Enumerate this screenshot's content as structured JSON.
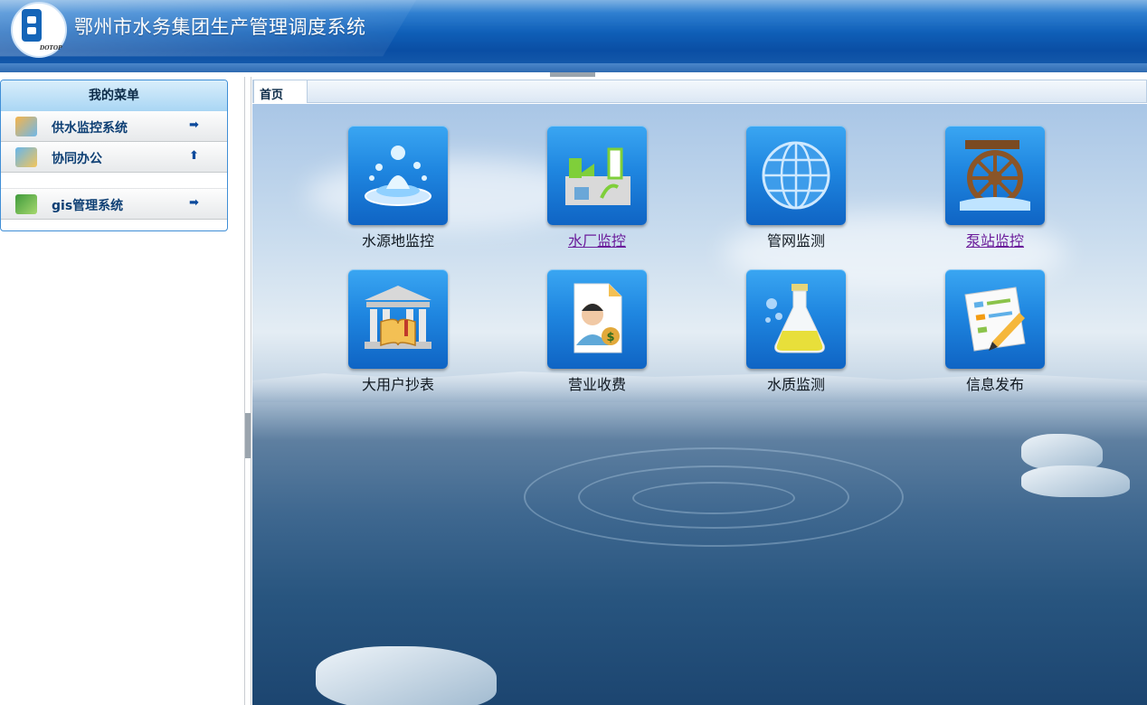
{
  "header": {
    "title": "鄂州市水务集团生产管理调度系统",
    "logo_text": "DOTOP"
  },
  "sidebar": {
    "title": "我的菜单",
    "items": [
      {
        "label": "供水监控系统",
        "arrow": "➡"
      },
      {
        "label": "协同办公",
        "arrow": "⬆"
      },
      {
        "label": "gis管理系统",
        "arrow": "➡"
      }
    ]
  },
  "tabs": [
    {
      "label": "首页"
    }
  ],
  "tiles": [
    {
      "label": "水源地监控",
      "icon": "water-splash-icon"
    },
    {
      "label": "水厂监控",
      "icon": "factory-icon"
    },
    {
      "label": "管网监测",
      "icon": "globe-icon"
    },
    {
      "label": "泵站监控",
      "icon": "water-wheel-icon"
    },
    {
      "label": "大用户抄表",
      "icon": "building-book-icon"
    },
    {
      "label": "营业收费",
      "icon": "billing-person-icon"
    },
    {
      "label": "水质监测",
      "icon": "flask-icon"
    },
    {
      "label": "信息发布",
      "icon": "document-pencil-icon"
    }
  ],
  "colors": {
    "tile_blue": "#1f86e0",
    "link_visited": "#6a1b9a",
    "header_blue": "#0f5fb8"
  }
}
